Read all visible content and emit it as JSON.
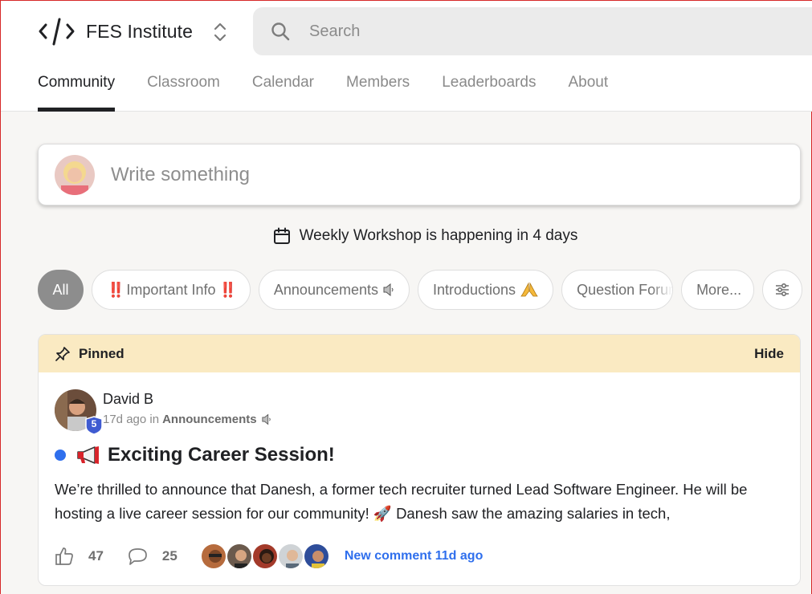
{
  "brand": {
    "name": "FES Institute",
    "logo_icon": "code-brackets-icon",
    "switcher_icon": "chevron-up-down-icon"
  },
  "search": {
    "placeholder": "Search",
    "icon": "search-icon"
  },
  "nav": {
    "tabs": [
      {
        "label": "Community",
        "active": true
      },
      {
        "label": "Classroom",
        "active": false
      },
      {
        "label": "Calendar",
        "active": false
      },
      {
        "label": "Members",
        "active": false
      },
      {
        "label": "Leaderboards",
        "active": false
      },
      {
        "label": "About",
        "active": false
      }
    ]
  },
  "composer": {
    "placeholder": "Write something"
  },
  "event": {
    "icon": "calendar-icon",
    "name": "Weekly Workshop",
    "suffix": " is happening in 4 days"
  },
  "filters": {
    "all_label": "All",
    "important": {
      "label": "Important Info",
      "marks": "‼️"
    },
    "announcements": {
      "label": "Announcements",
      "emoji": "speaker-icon"
    },
    "introductions": {
      "label": "Introductions",
      "emoji": "folded-hands-icon"
    },
    "question_forum": {
      "label": "Question Forum"
    },
    "more_label": "More...",
    "settings_icon": "sliders-icon"
  },
  "post": {
    "pinned_label": "Pinned",
    "hide_label": "Hide",
    "author": "David B",
    "level": "5",
    "time": "17d ago in",
    "category": "Announcements",
    "title": "Exciting Career Session!",
    "body": "We’re thrilled to announce that Danesh, a former tech recruiter turned Lead Software Engineer. He will be hosting a live career session for our community! 🚀 Danesh saw the amazing salaries in tech,",
    "likes": "47",
    "comments": "25",
    "new_comment": "New comment 11d ago",
    "colors": {
      "pinned_bg": "#faeac2",
      "unread_dot": "#2f6fed",
      "link": "#2f6fed",
      "level_badge": "#3f5bd1"
    }
  }
}
